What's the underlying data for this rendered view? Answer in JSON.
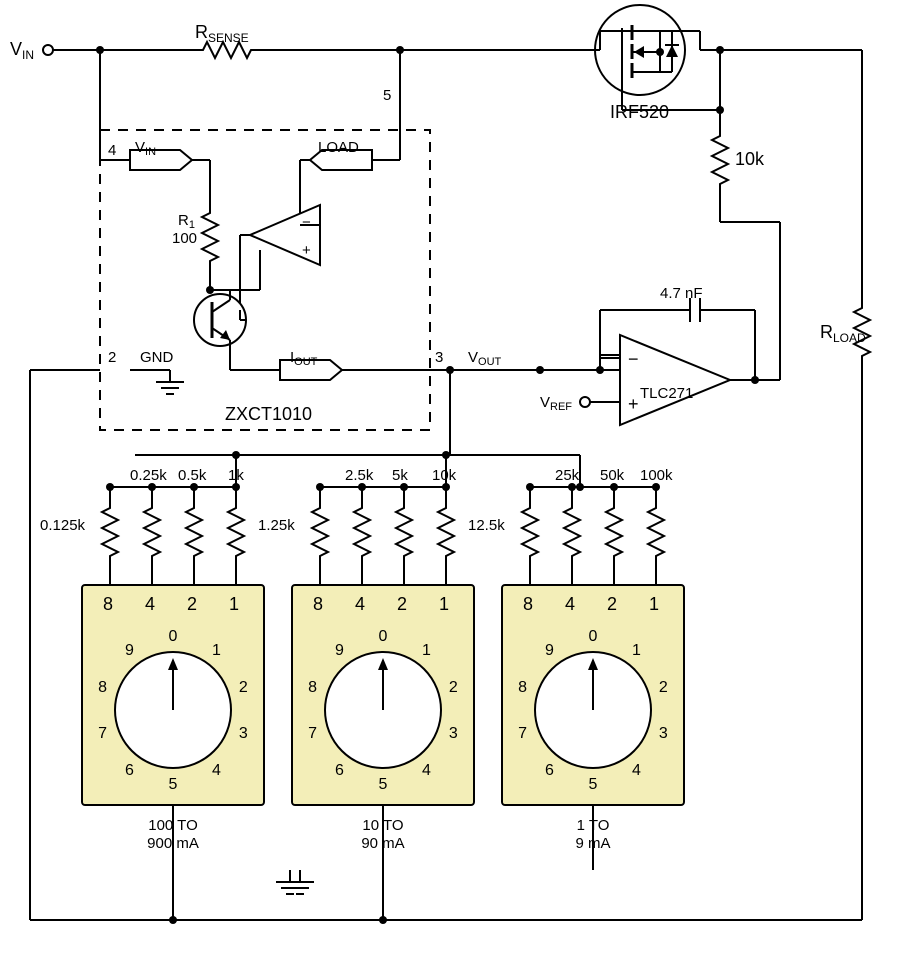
{
  "labels": {
    "vin": "V",
    "vin_sub": "IN",
    "rsense": "R",
    "rsense_sub": "SENSE",
    "irf520": "IRF520",
    "r10k": "10k",
    "rload": "R",
    "rload_sub": "LOAD",
    "cap": "4.7 nF",
    "tlc271": "TLC271",
    "vref": "V",
    "vref_sub": "REF",
    "vout": "V",
    "vout_sub": "OUT",
    "iout": "I",
    "iout_sub": "OUT",
    "zxct": "ZXCT1010",
    "gnd": "GND",
    "r1": "R",
    "r1_sub": "1",
    "r1_val": "100",
    "internal_vin": "V",
    "internal_vin_sub": "IN",
    "load": "LOAD",
    "pin2": "2",
    "pin3": "3",
    "pin4": "4",
    "pin5": "5"
  },
  "banks": [
    {
      "top": [
        "8",
        "4",
        "2",
        "1"
      ],
      "res": [
        "0.125k",
        "0.25k",
        "0.5k",
        "1k"
      ],
      "range": "100 TO\n900 mA"
    },
    {
      "top": [
        "8",
        "4",
        "2",
        "1"
      ],
      "res": [
        "1.25k",
        "2.5k",
        "5k",
        "10k"
      ],
      "range": "10 TO\n90 mA"
    },
    {
      "top": [
        "8",
        "4",
        "2",
        "1"
      ],
      "res": [
        "12.5k",
        "25k",
        "50k",
        "100k"
      ],
      "range": "1 TO\n9 mA"
    }
  ],
  "dial": [
    "0",
    "1",
    "2",
    "3",
    "4",
    "5",
    "6",
    "7",
    "8",
    "9"
  ]
}
